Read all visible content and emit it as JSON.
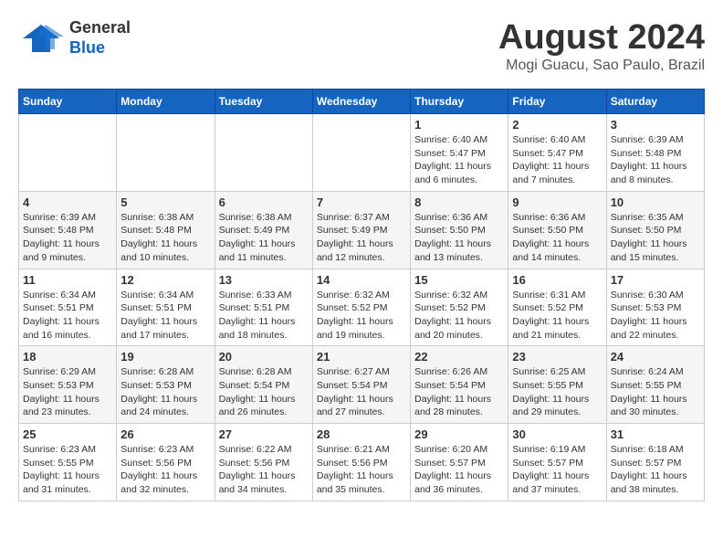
{
  "header": {
    "logo": {
      "line1": "General",
      "line2": "Blue"
    },
    "title": "August 2024",
    "location": "Mogi Guacu, Sao Paulo, Brazil"
  },
  "weekdays": [
    "Sunday",
    "Monday",
    "Tuesday",
    "Wednesday",
    "Thursday",
    "Friday",
    "Saturday"
  ],
  "weeks": [
    [
      {
        "day": "",
        "info": ""
      },
      {
        "day": "",
        "info": ""
      },
      {
        "day": "",
        "info": ""
      },
      {
        "day": "",
        "info": ""
      },
      {
        "day": "1",
        "info": "Sunrise: 6:40 AM\nSunset: 5:47 PM\nDaylight: 11 hours\nand 6 minutes."
      },
      {
        "day": "2",
        "info": "Sunrise: 6:40 AM\nSunset: 5:47 PM\nDaylight: 11 hours\nand 7 minutes."
      },
      {
        "day": "3",
        "info": "Sunrise: 6:39 AM\nSunset: 5:48 PM\nDaylight: 11 hours\nand 8 minutes."
      }
    ],
    [
      {
        "day": "4",
        "info": "Sunrise: 6:39 AM\nSunset: 5:48 PM\nDaylight: 11 hours\nand 9 minutes."
      },
      {
        "day": "5",
        "info": "Sunrise: 6:38 AM\nSunset: 5:48 PM\nDaylight: 11 hours\nand 10 minutes."
      },
      {
        "day": "6",
        "info": "Sunrise: 6:38 AM\nSunset: 5:49 PM\nDaylight: 11 hours\nand 11 minutes."
      },
      {
        "day": "7",
        "info": "Sunrise: 6:37 AM\nSunset: 5:49 PM\nDaylight: 11 hours\nand 12 minutes."
      },
      {
        "day": "8",
        "info": "Sunrise: 6:36 AM\nSunset: 5:50 PM\nDaylight: 11 hours\nand 13 minutes."
      },
      {
        "day": "9",
        "info": "Sunrise: 6:36 AM\nSunset: 5:50 PM\nDaylight: 11 hours\nand 14 minutes."
      },
      {
        "day": "10",
        "info": "Sunrise: 6:35 AM\nSunset: 5:50 PM\nDaylight: 11 hours\nand 15 minutes."
      }
    ],
    [
      {
        "day": "11",
        "info": "Sunrise: 6:34 AM\nSunset: 5:51 PM\nDaylight: 11 hours\nand 16 minutes."
      },
      {
        "day": "12",
        "info": "Sunrise: 6:34 AM\nSunset: 5:51 PM\nDaylight: 11 hours\nand 17 minutes."
      },
      {
        "day": "13",
        "info": "Sunrise: 6:33 AM\nSunset: 5:51 PM\nDaylight: 11 hours\nand 18 minutes."
      },
      {
        "day": "14",
        "info": "Sunrise: 6:32 AM\nSunset: 5:52 PM\nDaylight: 11 hours\nand 19 minutes."
      },
      {
        "day": "15",
        "info": "Sunrise: 6:32 AM\nSunset: 5:52 PM\nDaylight: 11 hours\nand 20 minutes."
      },
      {
        "day": "16",
        "info": "Sunrise: 6:31 AM\nSunset: 5:52 PM\nDaylight: 11 hours\nand 21 minutes."
      },
      {
        "day": "17",
        "info": "Sunrise: 6:30 AM\nSunset: 5:53 PM\nDaylight: 11 hours\nand 22 minutes."
      }
    ],
    [
      {
        "day": "18",
        "info": "Sunrise: 6:29 AM\nSunset: 5:53 PM\nDaylight: 11 hours\nand 23 minutes."
      },
      {
        "day": "19",
        "info": "Sunrise: 6:28 AM\nSunset: 5:53 PM\nDaylight: 11 hours\nand 24 minutes."
      },
      {
        "day": "20",
        "info": "Sunrise: 6:28 AM\nSunset: 5:54 PM\nDaylight: 11 hours\nand 26 minutes."
      },
      {
        "day": "21",
        "info": "Sunrise: 6:27 AM\nSunset: 5:54 PM\nDaylight: 11 hours\nand 27 minutes."
      },
      {
        "day": "22",
        "info": "Sunrise: 6:26 AM\nSunset: 5:54 PM\nDaylight: 11 hours\nand 28 minutes."
      },
      {
        "day": "23",
        "info": "Sunrise: 6:25 AM\nSunset: 5:55 PM\nDaylight: 11 hours\nand 29 minutes."
      },
      {
        "day": "24",
        "info": "Sunrise: 6:24 AM\nSunset: 5:55 PM\nDaylight: 11 hours\nand 30 minutes."
      }
    ],
    [
      {
        "day": "25",
        "info": "Sunrise: 6:23 AM\nSunset: 5:55 PM\nDaylight: 11 hours\nand 31 minutes."
      },
      {
        "day": "26",
        "info": "Sunrise: 6:23 AM\nSunset: 5:56 PM\nDaylight: 11 hours\nand 32 minutes."
      },
      {
        "day": "27",
        "info": "Sunrise: 6:22 AM\nSunset: 5:56 PM\nDaylight: 11 hours\nand 34 minutes."
      },
      {
        "day": "28",
        "info": "Sunrise: 6:21 AM\nSunset: 5:56 PM\nDaylight: 11 hours\nand 35 minutes."
      },
      {
        "day": "29",
        "info": "Sunrise: 6:20 AM\nSunset: 5:57 PM\nDaylight: 11 hours\nand 36 minutes."
      },
      {
        "day": "30",
        "info": "Sunrise: 6:19 AM\nSunset: 5:57 PM\nDaylight: 11 hours\nand 37 minutes."
      },
      {
        "day": "31",
        "info": "Sunrise: 6:18 AM\nSunset: 5:57 PM\nDaylight: 11 hours\nand 38 minutes."
      }
    ]
  ]
}
